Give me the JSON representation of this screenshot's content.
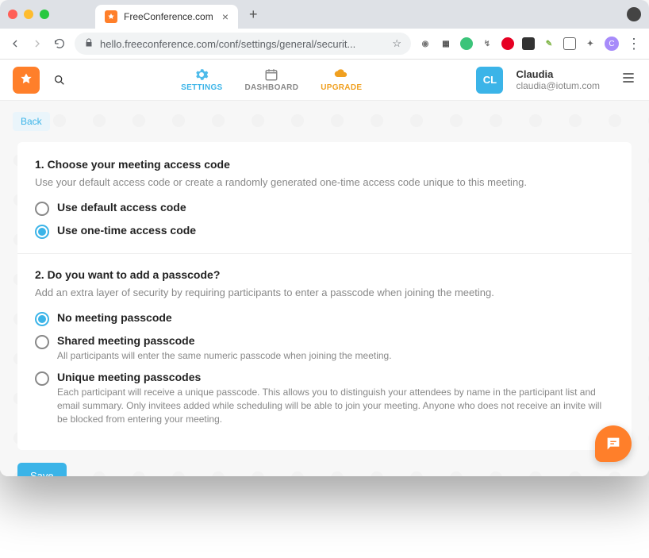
{
  "browser": {
    "tab_title": "FreeConference.com",
    "url": "hello.freeconference.com/conf/settings/general/securit..."
  },
  "header": {
    "nav": {
      "settings": "SETTINGS",
      "dashboard": "DASHBOARD",
      "upgrade": "UPGRADE"
    },
    "user": {
      "initials": "CL",
      "name": "Claudia",
      "email": "claudia@iotum.com"
    }
  },
  "back_label": "Back",
  "section1": {
    "title": "1. Choose your meeting access code",
    "desc": "Use your default access code or create a randomly generated one-time access code unique to this meeting.",
    "options": [
      {
        "label": "Use default access code"
      },
      {
        "label": "Use one-time access code"
      }
    ]
  },
  "section2": {
    "title": "2. Do you want to add a passcode?",
    "desc": "Add an extra layer of security by requiring participants to enter a passcode when joining the meeting.",
    "options": [
      {
        "label": "No meeting passcode"
      },
      {
        "label": "Shared meeting passcode",
        "hint": "All participants will enter the same numeric passcode when joining the meeting."
      },
      {
        "label": "Unique meeting passcodes",
        "hint": "Each participant will receive a unique passcode. This allows you to distinguish your attendees by name in the participant list and email summary. Only invitees added while scheduling will be able to join your meeting. Anyone who does not receive an invite will be blocked from entering your meeting."
      }
    ]
  },
  "save_label": "Save"
}
